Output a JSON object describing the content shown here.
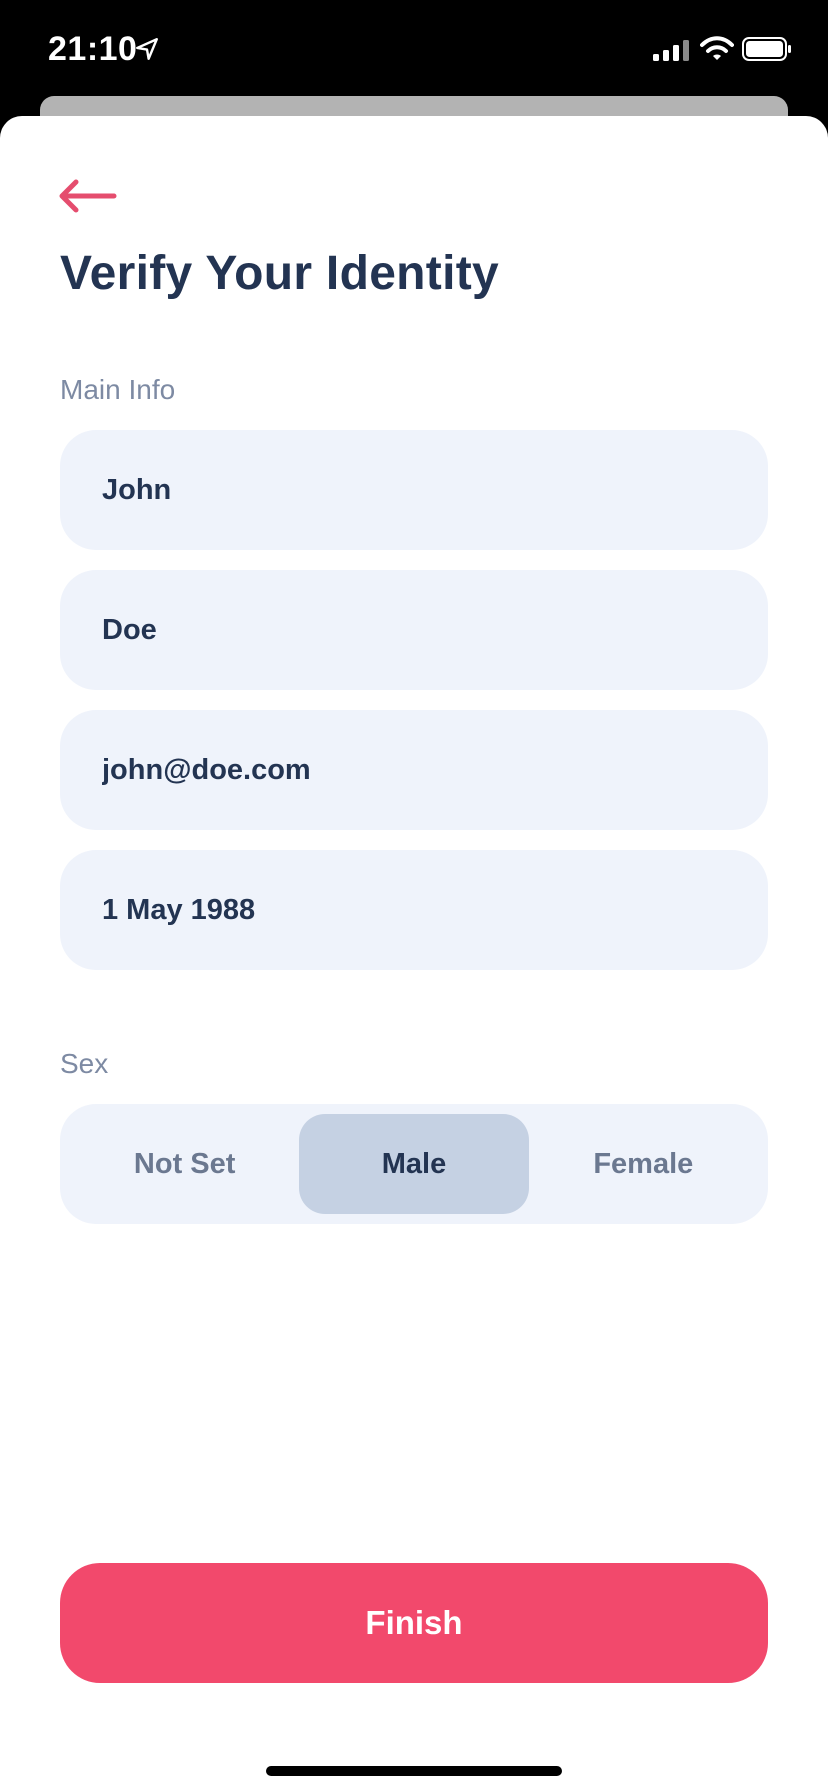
{
  "status_bar": {
    "time": "21:10",
    "icons": [
      "location-arrow-icon",
      "cellular-signal-icon",
      "wifi-icon",
      "battery-icon"
    ]
  },
  "header": {
    "back_icon": "arrow-left-icon",
    "title": "Verify Your Identity"
  },
  "main_info": {
    "label": "Main Info",
    "first_name": "John",
    "last_name": "Doe",
    "email": "john@doe.com",
    "birth_date": "1 May 1988"
  },
  "sex": {
    "label": "Sex",
    "options": [
      "Not Set",
      "Male",
      "Female"
    ],
    "selected": "Male"
  },
  "footer": {
    "finish_label": "Finish"
  },
  "colors": {
    "accent": "#f2496c",
    "title": "#233452",
    "field_bg": "#eff3fb",
    "segment_selected": "#c5d1e3",
    "muted_label": "#7d8aa3"
  }
}
